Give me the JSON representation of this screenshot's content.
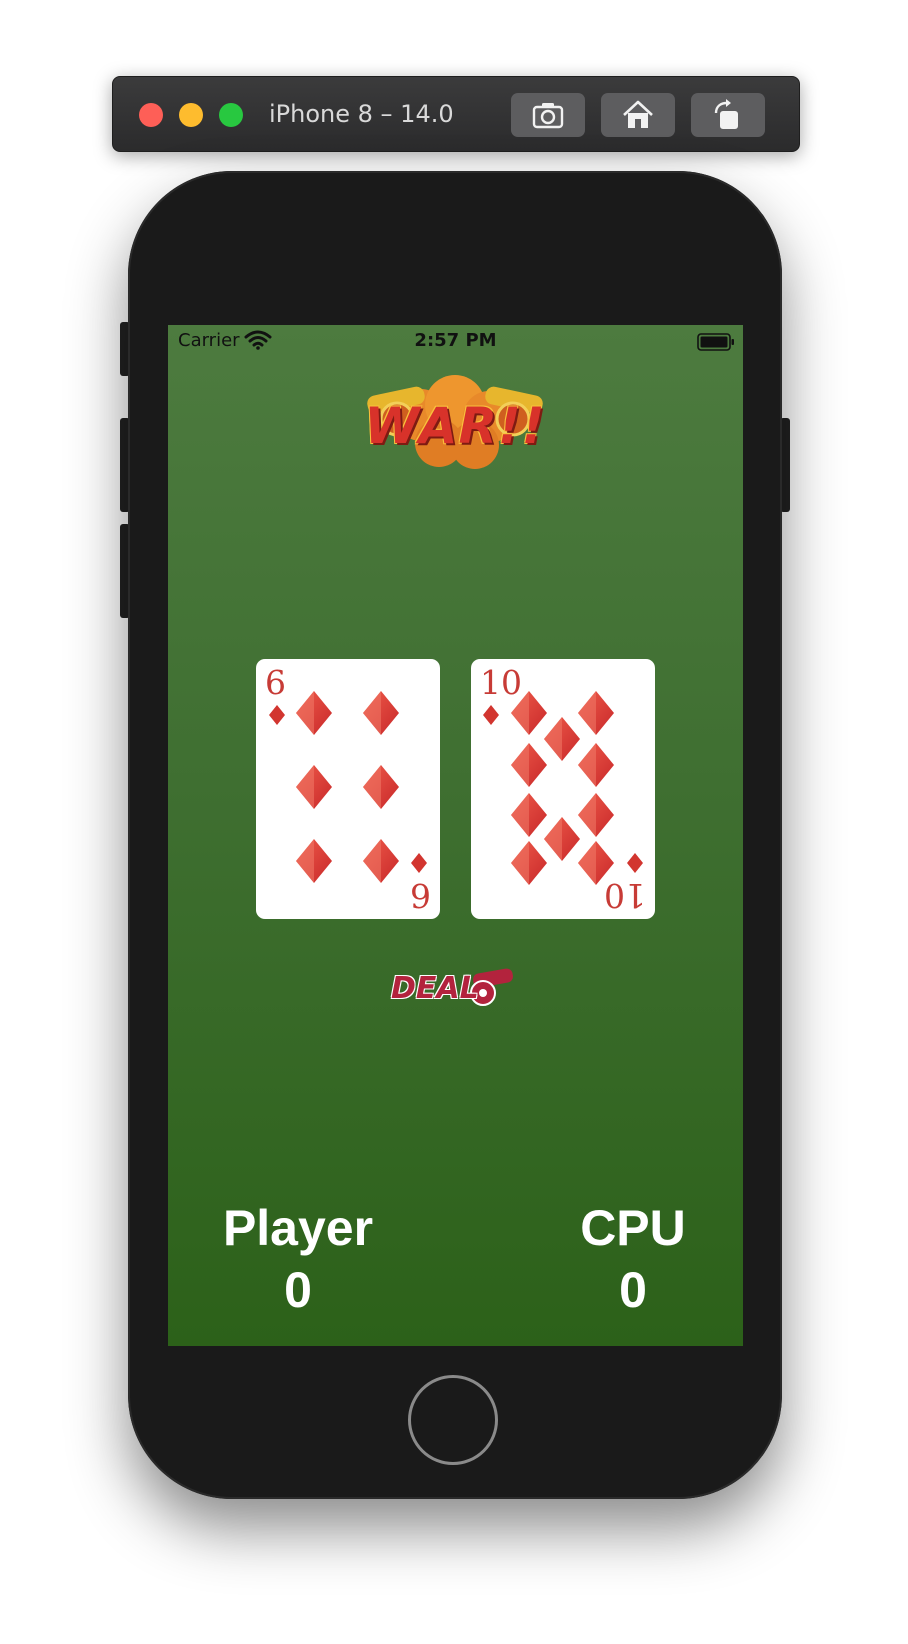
{
  "simulator": {
    "title": "iPhone 8 – 14.0",
    "buttons": [
      "screenshot-icon",
      "home-icon",
      "rotate-icon"
    ]
  },
  "status_bar": {
    "carrier": "Carrier",
    "time": "2:57 PM"
  },
  "app": {
    "logo_text": "WAR!!",
    "player_card": {
      "rank": "6",
      "suit": "diamonds"
    },
    "cpu_card": {
      "rank": "10",
      "suit": "diamonds"
    },
    "deal_label": "DEAL",
    "player": {
      "label": "Player",
      "score": "0"
    },
    "cpu": {
      "label": "CPU",
      "score": "0"
    }
  },
  "colors": {
    "table_top": "#4d7b3f",
    "table_bottom": "#2c6119",
    "suit_red": "#d2352f"
  }
}
